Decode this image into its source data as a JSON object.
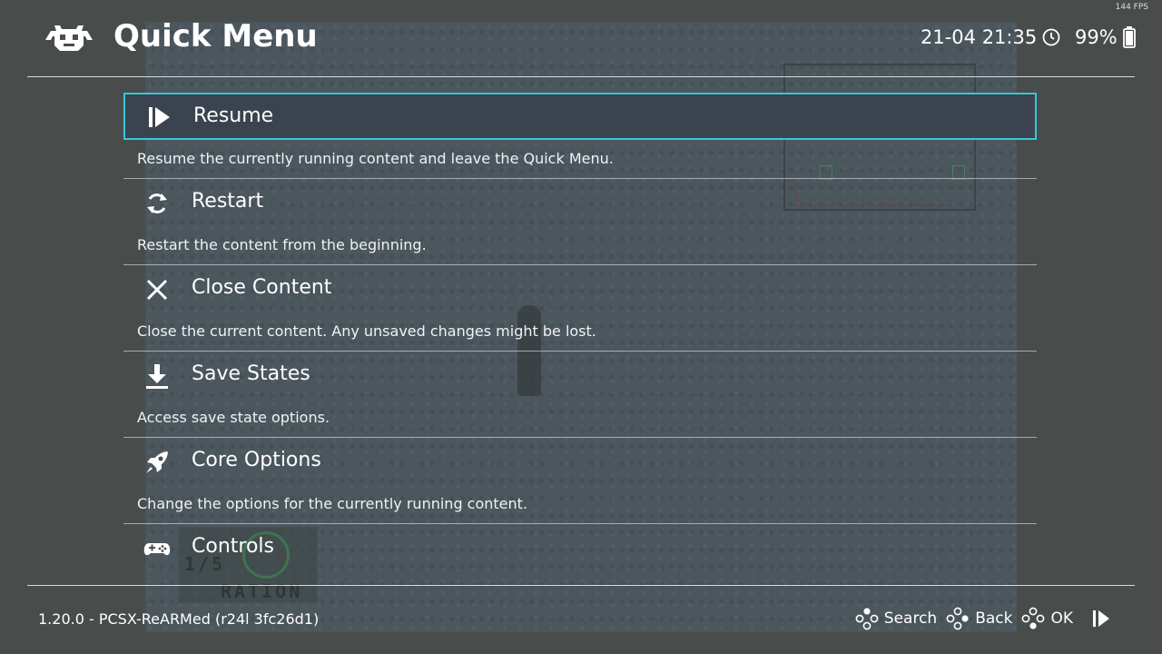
{
  "fps": "144 FPS",
  "header": {
    "title": "Quick Menu",
    "datetime": "21-04 21:35",
    "battery": "99%"
  },
  "menu": {
    "items": [
      {
        "label": "Resume",
        "description": "Resume the currently running content and leave the Quick Menu.",
        "icon": "resume-icon",
        "selected": true
      },
      {
        "label": "Restart",
        "description": "Restart the content from the beginning.",
        "icon": "restart-icon"
      },
      {
        "label": "Close Content",
        "description": "Close the current content. Any unsaved changes might be lost.",
        "icon": "close-icon"
      },
      {
        "label": "Save States",
        "description": "Access save state options.",
        "icon": "download-icon"
      },
      {
        "label": "Core Options",
        "description": "Change the options for the currently running content.",
        "icon": "rocket-icon"
      },
      {
        "label": "Controls",
        "description": "",
        "icon": "gamepad-icon"
      }
    ]
  },
  "footer": {
    "version": "1.20.0 - PCSX-ReARMed (r24l 3fc26d1)",
    "actions": {
      "search": "Search",
      "back": "Back",
      "ok": "OK"
    }
  },
  "game_overlay": {
    "ration_top": "1/5",
    "ration_bottom": "RATION"
  },
  "colors": {
    "selection_border": "#36c8d8",
    "selection_fill": "#3b4350",
    "background": "#4a4d4c"
  }
}
